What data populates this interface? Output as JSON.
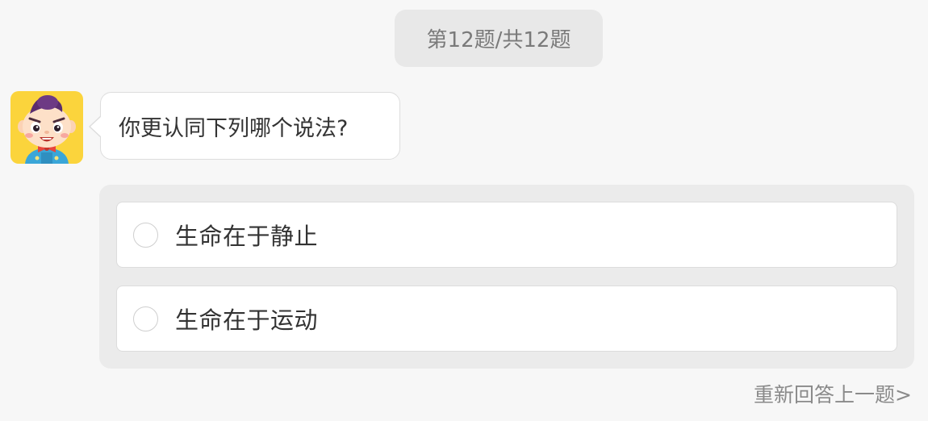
{
  "header": {
    "progress_text": "第12题/共12题"
  },
  "chat": {
    "avatar_icon": "cartoon-boy-avatar",
    "question": "你更认同下列哪个说法?"
  },
  "options": [
    {
      "label": "生命在于静止",
      "selected": false
    },
    {
      "label": "生命在于运动",
      "selected": false
    }
  ],
  "footer": {
    "redo_link": "重新回答上一题>"
  },
  "colors": {
    "background": "#f7f7f7",
    "pill": "#e8e8e8",
    "panel": "#ebebeb",
    "avatar_bg": "#fbd43c"
  }
}
